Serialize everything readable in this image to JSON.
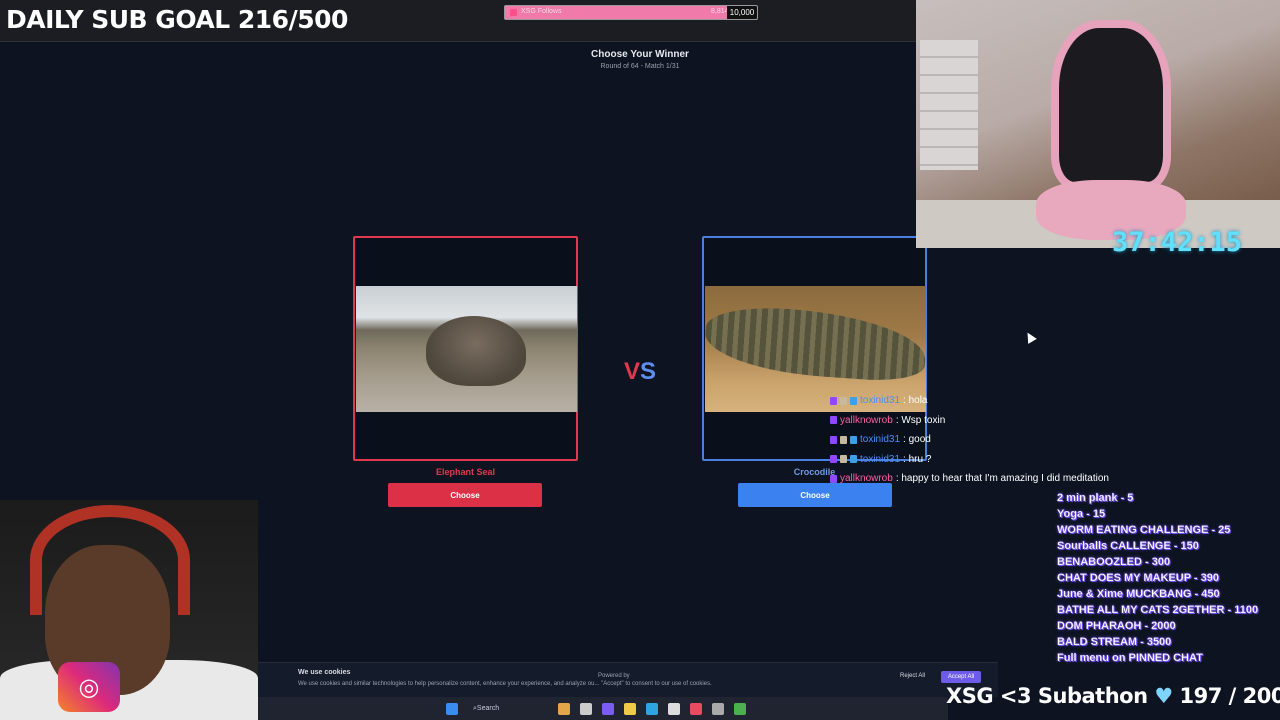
{
  "overlay": {
    "sub_goal": "DAILY SUB GOAL 216/500",
    "follow_goal": {
      "label": "XSG Follows",
      "current": "8,814",
      "target": "10,000",
      "progress": 0.8814
    },
    "timer": "37:42:15",
    "subathon": {
      "label": "XSG <3 Subathon",
      "count": "197 / 200"
    }
  },
  "page": {
    "title": "Choose Your Winner",
    "subtitle": "Round of 64 - Match 1/31",
    "vs": {
      "v": "V",
      "s": "S"
    },
    "left": {
      "name": "Elephant Seal",
      "button": "Choose"
    },
    "right": {
      "name": "Crocodile",
      "button": "Choose"
    }
  },
  "chat": [
    {
      "user": "toxinid31",
      "message": ": hola",
      "color": "#4e8df5"
    },
    {
      "user": "yallknowrob",
      "message": ": Wsp toxin",
      "color": "#ff5fa2"
    },
    {
      "user": "toxinid31",
      "message": ": good",
      "color": "#4e8df5"
    },
    {
      "user": "toxinid31",
      "message": ": hru ?",
      "color": "#4e8df5"
    },
    {
      "user": "yallknowrob",
      "message": ": happy to hear that I'm amazing I did meditation",
      "color": "#ff5fa2"
    }
  ],
  "menu": [
    "2 min plank - 5",
    "Yoga - 15",
    "WORM EATING CHALLENGE - 25",
    "Sourballs CALLENGE - 150",
    "BENABOOZLED - 300",
    "CHAT DOES MY MAKEUP - 390",
    "June & Xime MUCKBANG - 450",
    "BATHE ALL MY CATS 2GETHER - 1100",
    "DOM PHARAOH - 2000",
    "BALD STREAM - 3500",
    "Full menu on PINNED CHAT"
  ],
  "cookie": {
    "title": "We use cookies",
    "text": "We use cookies and similar technologies to help personalize content, enhance your experience, and analyze ou... \"Accept\" to consent to our use of cookies.",
    "powered": "Powered by",
    "reject": "Reject All",
    "accept": "Accept All"
  },
  "taskbar": {
    "search": "Search"
  },
  "colors": {
    "red": "#dc3046",
    "blue": "#3b82f0",
    "bg": "#0d1320",
    "timer": "#5fe0ff"
  }
}
